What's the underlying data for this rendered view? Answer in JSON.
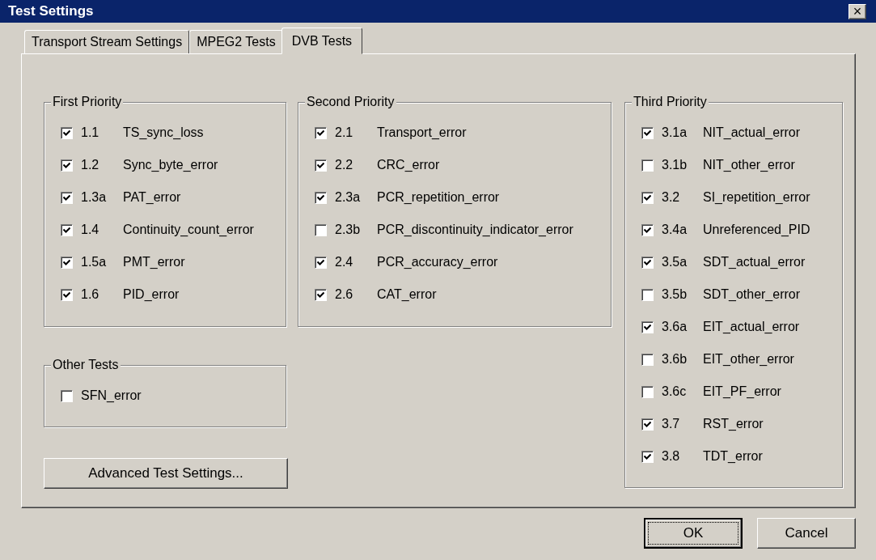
{
  "window": {
    "title": "Test Settings",
    "close": "×"
  },
  "tabs": [
    {
      "label": "Transport Stream Settings",
      "selected": false
    },
    {
      "label": "MPEG2 Tests",
      "selected": false
    },
    {
      "label": "DVB Tests",
      "selected": true
    }
  ],
  "groups": [
    {
      "title": "First Priority",
      "items": [
        {
          "number": "1.1",
          "label": "TS_sync_loss",
          "checked": true
        },
        {
          "number": "1.2",
          "label": "Sync_byte_error",
          "checked": true
        },
        {
          "number": "1.3a",
          "label": "PAT_error",
          "checked": true
        },
        {
          "number": "1.4",
          "label": "Continuity_count_error",
          "checked": true
        },
        {
          "number": "1.5a",
          "label": "PMT_error",
          "checked": true
        },
        {
          "number": "1.6",
          "label": "PID_error",
          "checked": true
        }
      ]
    },
    {
      "title": "Other Tests",
      "items": [
        {
          "label": "SFN_error",
          "checked": false
        }
      ]
    },
    {
      "title": "Second Priority",
      "items": [
        {
          "number": "2.1",
          "label": "Transport_error",
          "checked": true
        },
        {
          "number": "2.2",
          "label": "CRC_error",
          "checked": true
        },
        {
          "number": "2.3a",
          "label": "PCR_repetition_error",
          "checked": true
        },
        {
          "number": "2.3b",
          "label": "PCR_discontinuity_indicator_error",
          "checked": false
        },
        {
          "number": "2.4",
          "label": "PCR_accuracy_error",
          "checked": true
        },
        {
          "number": "2.6",
          "label": "CAT_error",
          "checked": true
        }
      ]
    },
    {
      "title": "Third Priority",
      "items": [
        {
          "number": "3.1a",
          "label": "NIT_actual_error",
          "checked": true
        },
        {
          "number": "3.1b",
          "label": "NIT_other_error",
          "checked": false
        },
        {
          "number": "3.2",
          "label": "SI_repetition_error",
          "checked": true
        },
        {
          "number": "3.4a",
          "label": "Unreferenced_PID",
          "checked": true
        },
        {
          "number": "3.5a",
          "label": "SDT_actual_error",
          "checked": true
        },
        {
          "number": "3.5b",
          "label": "SDT_other_error",
          "checked": false
        },
        {
          "number": "3.6a",
          "label": "EIT_actual_error",
          "checked": true
        },
        {
          "number": "3.6b",
          "label": "EIT_other_error",
          "checked": false
        },
        {
          "number": "3.6c",
          "label": "EIT_PF_error",
          "checked": false
        },
        {
          "number": "3.7",
          "label": "RST_error",
          "checked": true
        },
        {
          "number": "3.8",
          "label": "TDT_error",
          "checked": true
        }
      ]
    }
  ],
  "advanced_button": "Advanced Test Settings...",
  "buttons": [
    {
      "label": "OK",
      "default": true
    },
    {
      "label": "Cancel",
      "default": false
    }
  ]
}
